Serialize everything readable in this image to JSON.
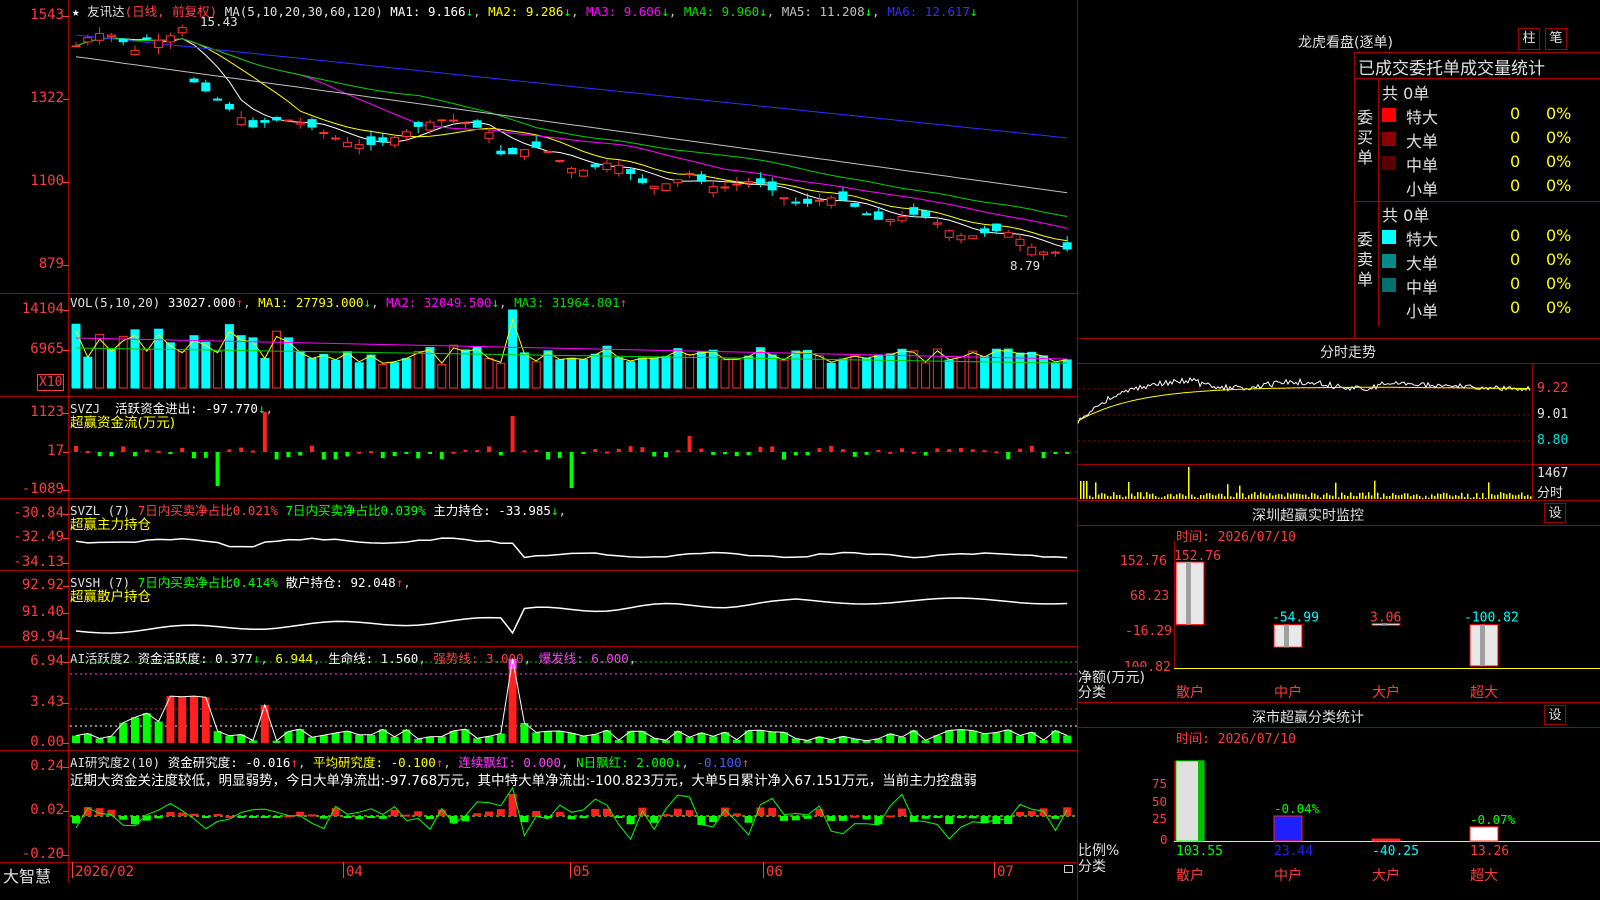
{
  "stock": {
    "name": "友讯达",
    "period": "(日线, 前复权)",
    "star": "★"
  },
  "main_chart": {
    "legend_prefix": "MA(5,10,20,30,60,120)",
    "ma": [
      {
        "label": "MA1:",
        "value": "9.166",
        "arrow": "↓",
        "color": "#ffffff"
      },
      {
        "label": "MA2:",
        "value": "9.286",
        "arrow": "↓",
        "color": "#ffff00"
      },
      {
        "label": "MA3:",
        "value": "9.606",
        "arrow": "↓",
        "color": "#ff00ff"
      },
      {
        "label": "MA4:",
        "value": "9.960",
        "arrow": "↓",
        "color": "#00e000"
      },
      {
        "label": "MA5:",
        "value": "11.208",
        "arrow": "↓",
        "color": "#c0c0c0"
      },
      {
        "label": "MA6:",
        "value": "12.617",
        "arrow": "↓",
        "color": "#3030ff"
      }
    ],
    "y_ticks": [
      "1543",
      "1322",
      "1100",
      "879"
    ],
    "high_mark": "15.43",
    "low_mark": "8.79"
  },
  "vol": {
    "legend": "VOL(5,10,20)",
    "value": "33027.000",
    "value_arrow": "↑",
    "ma": [
      {
        "label": "MA1:",
        "value": "27793.000",
        "arrow": "↓",
        "color": "#ffff00"
      },
      {
        "label": "MA2:",
        "value": "32049.500",
        "arrow": "↓",
        "color": "#ff00ff"
      },
      {
        "label": "MA3:",
        "value": "31964.801",
        "arrow": "↑",
        "color": "#00e000"
      }
    ],
    "y_ticks": [
      "14104",
      "6965"
    ],
    "unit": "X10"
  },
  "svzj": {
    "legend": "SVZJ",
    "item": "活跃资金进出:",
    "value": "-97.770",
    "arrow": "↓",
    "note": "超赢资金流(万元)",
    "y_ticks": [
      "1123",
      "17",
      "-1089"
    ]
  },
  "svzl": {
    "legend": "SVZL (7)",
    "a_label": "7日内买卖净占比",
    "a_value": "0.021%",
    "b_label": "7日内买卖净占比",
    "b_value": "0.039%",
    "c_label": "主力持仓:",
    "c_value": "-33.985",
    "c_arrow": "↓",
    "note": "超赢主力持仓",
    "y_ticks": [
      "-30.84",
      "-32.49",
      "-34.13"
    ]
  },
  "svsh": {
    "legend": "SVSH (7)",
    "a_label": "7日内买卖净占比",
    "a_value": "0.414%",
    "c_label": "散户持仓:",
    "c_value": "92.048",
    "c_arrow": "↑",
    "note": "超赢散户持仓",
    "y_ticks": [
      "92.92",
      "91.40",
      "89.94"
    ]
  },
  "ai_active": {
    "legend": "AI活跃度2",
    "a_label": "资金活跃度:",
    "a_value": "0.377",
    "a_arrow": "↓",
    "b_value": "6.944",
    "c_label": "生命线:",
    "c_value": "1.560",
    "d_label": "强势线:",
    "d_value": "3.000",
    "e_label": "爆发线:",
    "e_value": "6.000",
    "y_ticks": [
      "6.94",
      "3.43",
      "0.00"
    ]
  },
  "ai_research": {
    "legend": "AI研究度2(10)",
    "a_label": "资金研究度:",
    "a_value": "-0.016",
    "a_arrow": "↑",
    "b_label": "平均研究度:",
    "b_value": "-0.100",
    "b_arrow": "↑",
    "c_label": "连续飘红:",
    "c_value": "0.000",
    "d_label": "N日飘红:",
    "d_value": "2.000",
    "d_arrow": "↓",
    "e_value": "-0.100",
    "e_arrow": "↑",
    "note": "近期大资金关注度较低，明显弱势，今日大单净流出:-97.768万元，其中特大单净流出:-100.823万元，大单5日累计净入67.151万元，当前主力控盘弱",
    "y_ticks": [
      "0.24",
      "0.02",
      "-0.20"
    ]
  },
  "x_axis": {
    "brand": "大智慧",
    "labels": [
      "2026/02",
      "04",
      "05",
      "06",
      "07"
    ]
  },
  "lhb": {
    "title": "龙虎看盘(逐单)",
    "btn1": "柱",
    "btn2": "笔",
    "header": "已成交委托单成交量统计",
    "buy": {
      "side": "委买单",
      "total": "共 0单",
      "rows": [
        {
          "label": "特大",
          "count": "0",
          "pct": "0%",
          "color": "#ff0000"
        },
        {
          "label": "大单",
          "count": "0",
          "pct": "0%",
          "color": "#8b0000"
        },
        {
          "label": "中单",
          "count": "0",
          "pct": "0%",
          "color": "#5a0000"
        },
        {
          "label": "小单",
          "count": "0",
          "pct": "0%",
          "color": "#000000"
        }
      ]
    },
    "sell": {
      "side": "委卖单",
      "total": "共 0单",
      "rows": [
        {
          "label": "特大",
          "count": "0",
          "pct": "0%",
          "color": "#00ffff"
        },
        {
          "label": "大单",
          "count": "0",
          "pct": "0%",
          "color": "#008b8b"
        },
        {
          "label": "中单",
          "count": "0",
          "pct": "0%",
          "color": "#007070"
        },
        {
          "label": "小单",
          "count": "0",
          "pct": "0%",
          "color": "#000000"
        }
      ]
    }
  },
  "intraday": {
    "title": "分时走势",
    "y_ticks": [
      "9.22",
      "9.01",
      "8.80"
    ],
    "vol_tick": "1467",
    "vol_unit": "分时"
  },
  "monitor": {
    "title": "深圳超赢实时监控",
    "btn": "设",
    "time": "时间: 2026/07/10",
    "y_ticks": [
      "152.76",
      "68.23",
      "-16.29",
      "-100.82"
    ],
    "ylabel": "净额(万元)",
    "xlabel": "分类",
    "chart_data": {
      "type": "bar",
      "categories": [
        "散户",
        "中户",
        "大户",
        "超大"
      ],
      "values": [
        152.76,
        -54.99,
        3.06,
        -100.82
      ],
      "ylim": [
        -100.82,
        152.76
      ]
    },
    "value_labels": [
      "152.76",
      "-54.99",
      "3.06",
      "-100.82"
    ]
  },
  "classify": {
    "title": "深市超赢分类统计",
    "btn": "设",
    "time": "时间: 2026/07/10",
    "y_ticks": [
      "75",
      "50",
      "25",
      "0"
    ],
    "ylabel": "比例%",
    "xlabel": "分类",
    "chart_data": {
      "type": "bar",
      "categories": [
        "散户",
        "中户",
        "大户",
        "超大"
      ],
      "values": [
        103.55,
        23.44,
        -40.25,
        13.26
      ],
      "changes": [
        "",
        "-0.04%",
        "",
        "-0.07%"
      ],
      "ylim": [
        0,
        75
      ]
    },
    "value_labels": [
      "103.55",
      "23.44",
      "-40.25",
      "13.26"
    ],
    "change_labels": [
      "",
      "-0.04%",
      "",
      "-0.07%"
    ]
  }
}
